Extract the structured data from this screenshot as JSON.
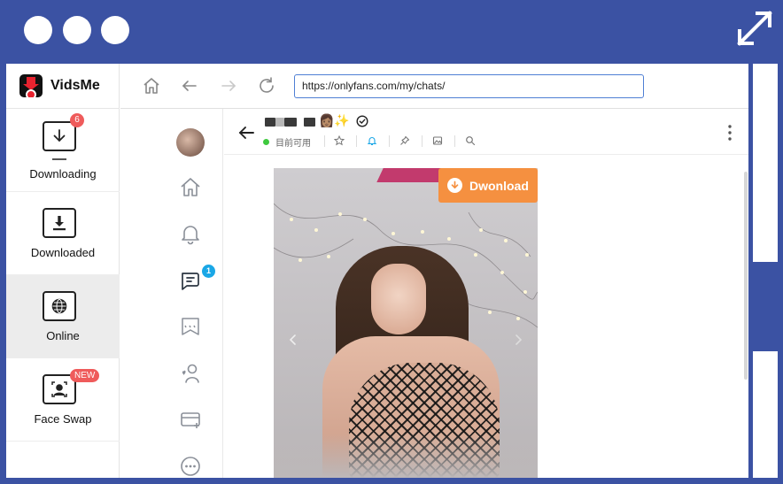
{
  "app": {
    "name": "VidsMe"
  },
  "sidebar": {
    "items": [
      {
        "label": "Downloading",
        "badge": "6"
      },
      {
        "label": "Downloaded"
      },
      {
        "label": "Online"
      },
      {
        "label": "Face Swap",
        "badge": "NEW"
      }
    ]
  },
  "browser": {
    "url": "https://onlyfans.com/my/chats/"
  },
  "rail": {
    "messages_badge": "1"
  },
  "chat": {
    "status": "目前可用",
    "name_emojis": "👩🏽✨"
  },
  "media": {
    "download_label": "Dwonload"
  },
  "colors": {
    "frame_blue": "#3b52a3",
    "accent_orange": "#f59040",
    "badge_red": "#ef5b5b",
    "badge_blue": "#1aa7e6",
    "url_border": "#4f7fd4",
    "online_green": "#3ec93e"
  }
}
